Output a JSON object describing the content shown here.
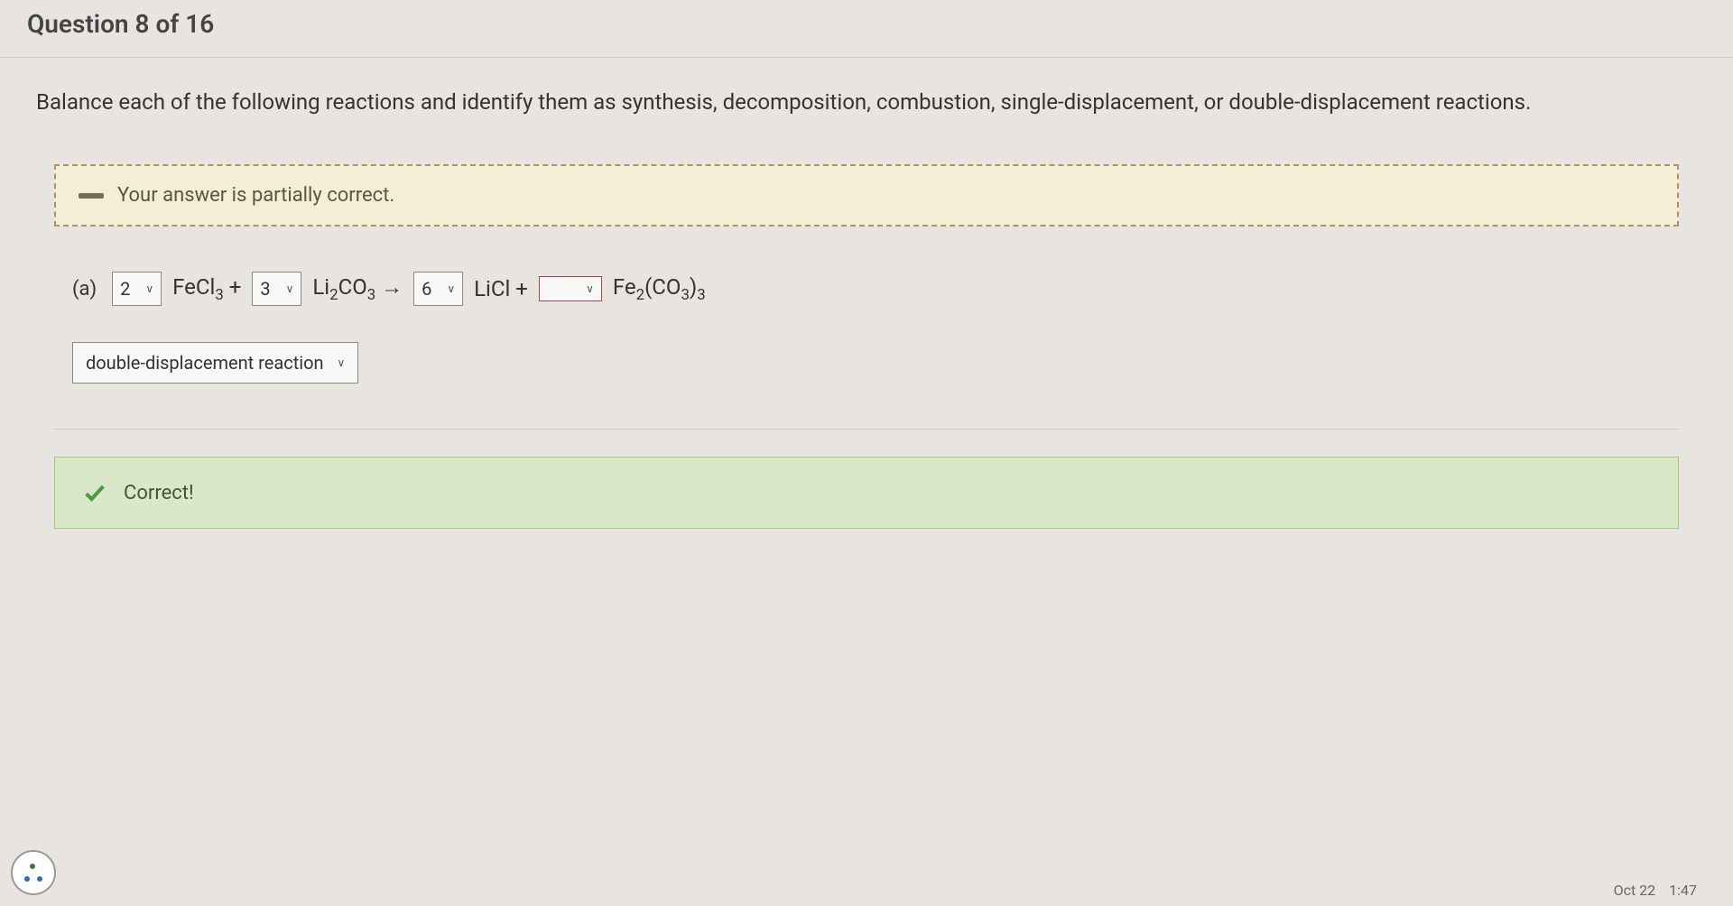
{
  "question_header": "Question 8 of 16",
  "prompt": "Balance each of the following reactions and identify them as synthesis, decomposition, combustion, single-displacement, or double-displacement reactions.",
  "feedback": {
    "text": "Your answer is partially correct."
  },
  "equation": {
    "part_label": "(a)",
    "coef1": "2",
    "reactant1_html": "FeCl<sub>3</sub> +",
    "coef2": "3",
    "reactant2_html": "Li<sub>2</sub>CO<sub>3</sub> →",
    "coef3": "6",
    "product1_html": "LiCl +",
    "coef4": "",
    "product2_html": "Fe<sub>2</sub>(CO<sub>3</sub>)<sub>3</sub>"
  },
  "reaction_type": {
    "selected": "double-displacement reaction"
  },
  "correct": {
    "text": "Correct!"
  },
  "footer": {
    "date": "Oct 22",
    "time": "1:47"
  }
}
